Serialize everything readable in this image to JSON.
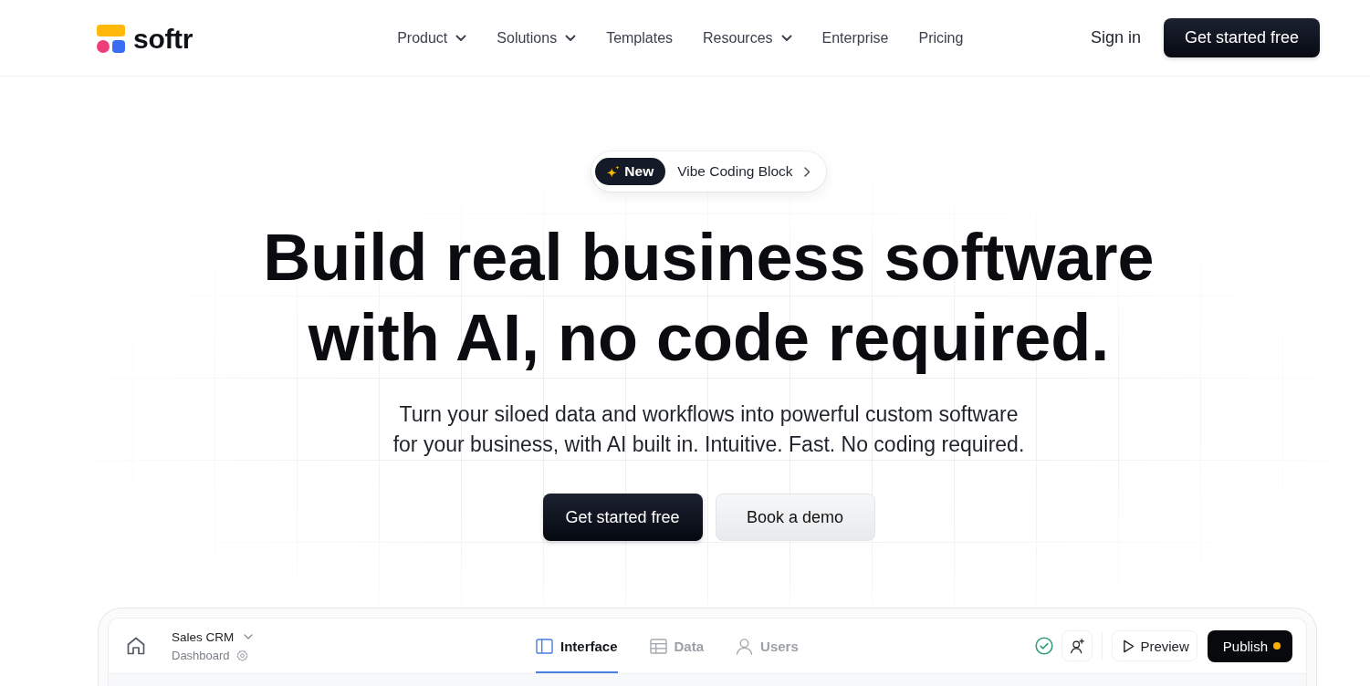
{
  "header": {
    "logo": "softr",
    "nav": [
      {
        "label": "Product",
        "has_menu": true
      },
      {
        "label": "Solutions",
        "has_menu": true
      },
      {
        "label": "Templates",
        "has_menu": false
      },
      {
        "label": "Resources",
        "has_menu": true
      },
      {
        "label": "Enterprise",
        "has_menu": false
      },
      {
        "label": "Pricing",
        "has_menu": false
      }
    ],
    "sign_in": "Sign in",
    "cta": "Get started free"
  },
  "hero": {
    "announcement": {
      "badge": "New",
      "text": "Vibe Coding Block"
    },
    "headline": "Build real business software with AI, no code required.",
    "subtitle": "Turn your siloed data and workflows into powerful custom software for your business, with AI built in. Intuitive. Fast. No coding required.",
    "buttons": [
      {
        "label": "Get started free",
        "kind": "primary"
      },
      {
        "label": "Book a demo",
        "kind": "secondary"
      }
    ]
  },
  "app_preview": {
    "app_name": "Sales CRM",
    "page_name": "Dashboard",
    "tabs": [
      {
        "label": "Interface",
        "selected": true
      },
      {
        "label": "Data",
        "selected": false
      },
      {
        "label": "Users",
        "selected": false
      }
    ],
    "preview": "Preview",
    "publish": {
      "label": "Publish",
      "has_changes": true
    }
  }
}
